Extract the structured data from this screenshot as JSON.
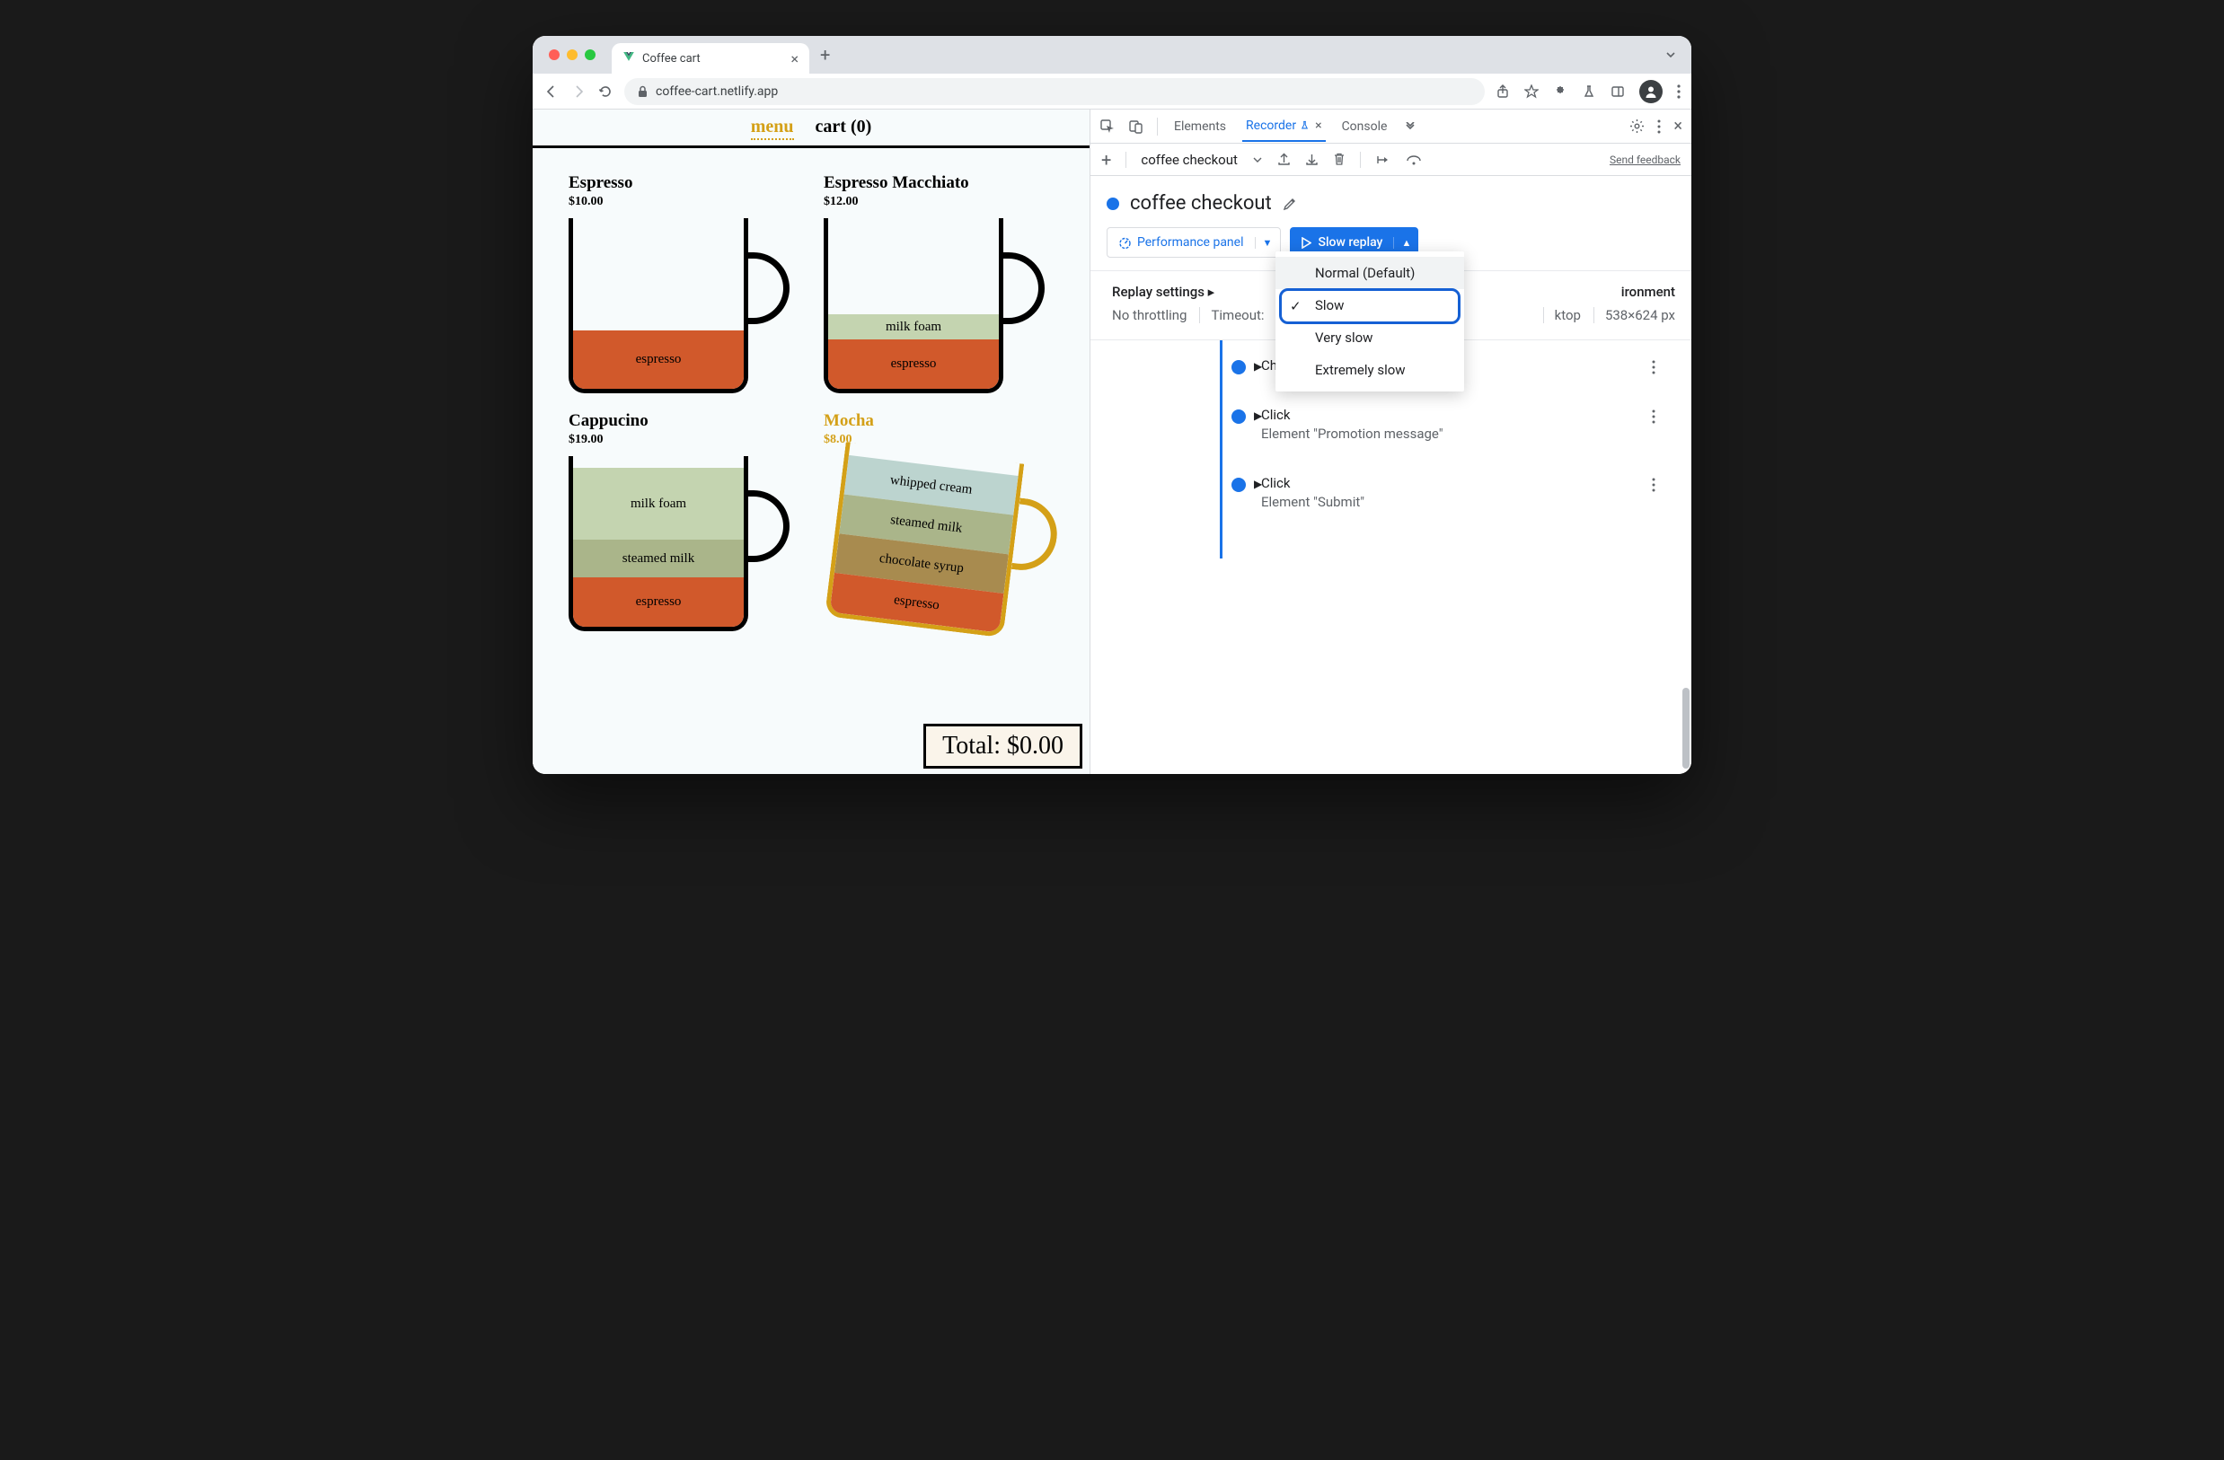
{
  "browser": {
    "tab_title": "Coffee cart",
    "url": "coffee-cart.netlify.app"
  },
  "page": {
    "nav_menu": "menu",
    "nav_cart": "cart (0)",
    "total_label": "Total: $0.00",
    "products": [
      {
        "name": "Espresso",
        "price": "$10.00",
        "layers": [
          {
            "label": "espresso",
            "cls": "esp",
            "h": 65
          }
        ]
      },
      {
        "name": "Espresso Macchiato",
        "price": "$12.00",
        "layers": [
          {
            "label": "milk foam",
            "cls": "foam",
            "h": 28
          },
          {
            "label": "espresso",
            "cls": "esp",
            "h": 55
          }
        ]
      },
      {
        "name": "Cappucino",
        "price": "$19.00",
        "layers": [
          {
            "label": "milk foam",
            "cls": "foam",
            "h": 80
          },
          {
            "label": "steamed milk",
            "cls": "stm",
            "h": 42
          },
          {
            "label": "espresso",
            "cls": "esp",
            "h": 55
          }
        ]
      },
      {
        "name": "Mocha",
        "price": "$8.00",
        "gold": true,
        "layers": [
          {
            "label": "whipped cream",
            "cls": "whip",
            "h": 44
          },
          {
            "label": "steamed milk",
            "cls": "stm",
            "h": 44
          },
          {
            "label": "chocolate syrup",
            "cls": "choc",
            "h": 44
          },
          {
            "label": "espresso",
            "cls": "esp",
            "h": 44
          }
        ]
      }
    ]
  },
  "devtools": {
    "tabs": {
      "elements": "Elements",
      "recorder": "Recorder",
      "console": "Console"
    },
    "toolbar": {
      "recording_select": "coffee checkout",
      "feedback": "Send feedback"
    },
    "recording_title": "coffee checkout",
    "perf_btn": "Performance panel",
    "replay_btn": "Slow replay",
    "dropdown": {
      "opt0": "Normal (Default)",
      "opt1": "Slow",
      "opt2": "Very slow",
      "opt3": "Extremely slow"
    },
    "settings": {
      "header": "Replay settings",
      "env_header_partial": "ironment",
      "throttle": "No throttling",
      "timeout": "Timeout:",
      "device_partial": "ktop",
      "viewport": "538×624 px"
    },
    "steps": [
      {
        "title": "Change",
        "sub": ""
      },
      {
        "title": "Click",
        "sub": "Element \"Promotion message\""
      },
      {
        "title": "Click",
        "sub": "Element \"Submit\""
      }
    ]
  }
}
